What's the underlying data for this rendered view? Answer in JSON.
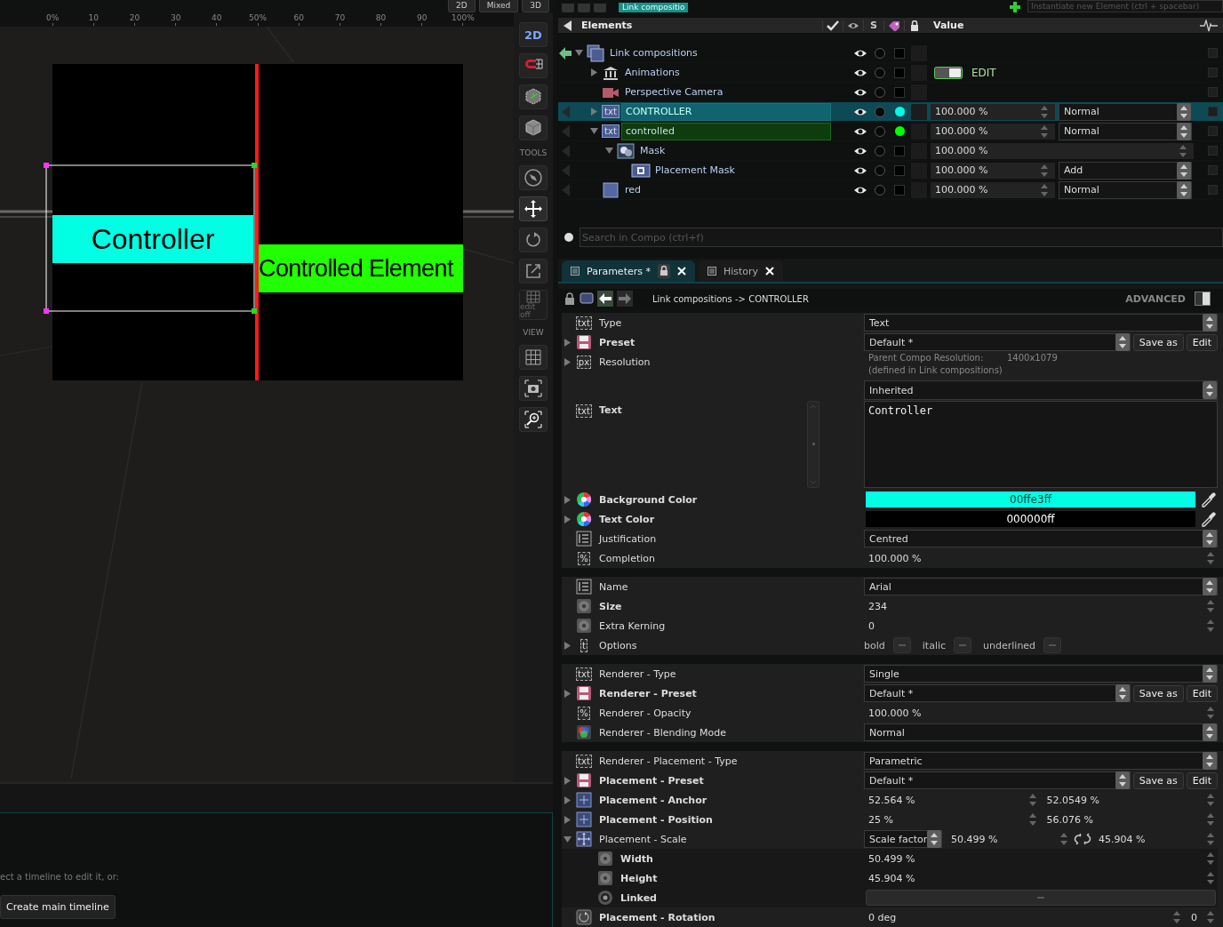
{
  "viewport": {
    "modes": [
      {
        "label": "2D"
      },
      {
        "label": "Mixed"
      },
      {
        "label": "3D"
      }
    ],
    "ruler": [
      "0%",
      "10",
      "20",
      "30",
      "40",
      "50%",
      "60",
      "70",
      "80",
      "90",
      "100%"
    ],
    "canvas": {
      "controller_text": "Controller",
      "controlled_text": "Controlled Element"
    }
  },
  "side_toolbar": {
    "items": [
      {
        "kind": "mode",
        "label": "2D"
      },
      {
        "kind": "magnet"
      },
      {
        "kind": "cube-axes"
      },
      {
        "kind": "cube"
      },
      {
        "kind": "heading",
        "label": "TOOLS"
      },
      {
        "kind": "compass",
        "selected": false
      },
      {
        "kind": "move",
        "selected": true
      },
      {
        "kind": "rotate",
        "selected": false
      },
      {
        "kind": "resize",
        "selected": false
      },
      {
        "kind": "grid-edit",
        "label": "edit off"
      },
      {
        "kind": "heading",
        "label": "VIEW"
      },
      {
        "kind": "grid"
      },
      {
        "kind": "snapshot"
      },
      {
        "kind": "zoom"
      }
    ]
  },
  "timeline": {
    "message": "ect a timeline to edit it, or:",
    "button": "Create main timeline"
  },
  "compo_bar": {
    "tab": "Link compositio",
    "instantiate": {
      "placeholder": "Instantiate new Element (ctrl + spacebar)"
    }
  },
  "elements": {
    "header": {
      "title": "Elements",
      "solo_column": "S",
      "value_column": "Value"
    },
    "rows": [
      {
        "name": "Link compositions",
        "kind": "composition",
        "active": true,
        "expanded": true,
        "visible": true,
        "solo": false,
        "selected": false,
        "children": [
          {
            "name": "Animations",
            "kind": "animations",
            "expanded": false,
            "visible": true,
            "solo": false,
            "selected": false,
            "edit": {
              "label": "EDIT",
              "on": true
            }
          },
          {
            "name": "Perspective Camera",
            "kind": "camera",
            "visible": true,
            "solo": false,
            "selected": false
          },
          {
            "name": "CONTROLLER",
            "kind": "text",
            "badge": "txt",
            "active": false,
            "expanded": false,
            "visible": true,
            "solo": false,
            "selected": true,
            "color": "#00ffe3",
            "opacity": "100.000 %",
            "blend": "Normal"
          },
          {
            "name": "controlled",
            "kind": "text",
            "badge": "txt",
            "active": false,
            "expanded": true,
            "visible": true,
            "solo": false,
            "selected": false,
            "target": true,
            "color": "#00ff00",
            "opacity": "100.000 %",
            "blend": "Normal",
            "children": [
              {
                "name": "Mask",
                "kind": "mask",
                "active": false,
                "expanded": true,
                "visible": true,
                "solo": false,
                "selected": false,
                "opacity": "100.000 %",
                "children": [
                  {
                    "name": "Placement Mask",
                    "kind": "placement",
                    "active": false,
                    "visible": true,
                    "solo": false,
                    "selected": false,
                    "opacity": "100.000 %",
                    "blend": "Add"
                  }
                ]
              }
            ]
          },
          {
            "name": "red",
            "kind": "shape",
            "active": false,
            "visible": true,
            "solo": false,
            "selected": false,
            "opacity": "100.000 %",
            "blend": "Normal"
          }
        ]
      }
    ]
  },
  "search": {
    "placeholder": "Search in Compo (ctrl+f)"
  },
  "params": {
    "tabs": [
      {
        "label": "Parameters *",
        "selected": true,
        "locked": true
      },
      {
        "label": "History",
        "selected": false,
        "locked": false
      }
    ],
    "breadcrumb": "Link compositions -> CONTROLLER",
    "advanced": {
      "label": "ADVANCED",
      "on": true
    },
    "groups": [
      {
        "rows": [
          {
            "badge": "txt",
            "label": "Type",
            "kind": "select",
            "value": "Text"
          },
          {
            "label": "Preset",
            "bold": true,
            "expanded": false,
            "kind": "preset",
            "value": "Default *",
            "buttons": [
              "Save as",
              "Edit"
            ]
          },
          {
            "badge": "px",
            "label": "Resolution",
            "expanded": false,
            "kind": "resolution",
            "info_label": "Parent Compo Resolution:",
            "info_value": "1400x1079",
            "note": "(defined in Link compositions)",
            "value": "Inherited"
          },
          {
            "badge": "txt",
            "label": "Text",
            "bold": true,
            "kind": "textarea",
            "value": "Controller"
          },
          {
            "label": "Background Color",
            "bold": true,
            "expanded": false,
            "kind": "color",
            "value": "00ffe3ff",
            "color": "#00ffe3"
          },
          {
            "label": "Text Color",
            "bold": true,
            "expanded": false,
            "kind": "color",
            "value": "000000ff",
            "color": "#000000"
          },
          {
            "label": "Justification",
            "kind": "select",
            "value": "Centred"
          },
          {
            "badge": "%",
            "label": "Completion",
            "kind": "number",
            "value": "100.000 %"
          }
        ]
      },
      {
        "rows": [
          {
            "label": "Name",
            "kind": "select",
            "value": "Arial"
          },
          {
            "label": "Size",
            "bold": true,
            "kind": "number",
            "value": "234"
          },
          {
            "label": "Extra Kerning",
            "kind": "number",
            "value": "0"
          },
          {
            "badge": "t",
            "label": "Options",
            "expanded": false,
            "kind": "toggles",
            "toggles": [
              {
                "label": "bold",
                "on": false
              },
              {
                "label": "italic",
                "on": false
              },
              {
                "label": "underlined",
                "on": false
              }
            ]
          }
        ]
      },
      {
        "rows": [
          {
            "badge": "txt",
            "label": "Renderer - Type",
            "kind": "select",
            "value": "Single"
          },
          {
            "label": "Renderer - Preset",
            "bold": true,
            "expanded": false,
            "kind": "preset",
            "value": "Default *",
            "buttons": [
              "Save as",
              "Edit"
            ]
          },
          {
            "badge": "%",
            "label": "Renderer - Opacity",
            "kind": "number",
            "value": "100.000 %"
          },
          {
            "label": "Renderer - Blending Mode",
            "kind": "blend_mode",
            "value": "Normal"
          }
        ]
      },
      {
        "rows": [
          {
            "badge": "txt",
            "label": "Renderer - Placement - Type",
            "kind": "select",
            "value": "Parametric"
          },
          {
            "label": "Placement - Preset",
            "bold": true,
            "expanded": false,
            "kind": "preset",
            "value": "Default *",
            "buttons": [
              "Save as",
              "Edit"
            ]
          },
          {
            "label": "Placement - Anchor",
            "bold": true,
            "expanded": false,
            "kind": "pair",
            "values": [
              "52.564 %",
              "52.0549 %"
            ]
          },
          {
            "label": "Placement - Position",
            "bold": true,
            "expanded": false,
            "kind": "pair",
            "values": [
              "25 %",
              "56.076 %"
            ]
          },
          {
            "label": "Placement - Scale",
            "expanded": true,
            "kind": "scale",
            "mode": "Scale factor",
            "values": [
              "50.499 %",
              "45.904 %"
            ],
            "linked": false,
            "children": [
              {
                "label": "Width",
                "bold": true,
                "kind": "number",
                "value": "50.499 %"
              },
              {
                "label": "Height",
                "bold": true,
                "kind": "number",
                "value": "45.904 %"
              },
              {
                "label": "Linked",
                "bold": true,
                "kind": "switch",
                "on": false
              }
            ]
          },
          {
            "label": "Placement - Rotation",
            "bold": true,
            "kind": "rotation",
            "value": "0 deg",
            "value_2": "0"
          }
        ]
      }
    ]
  }
}
